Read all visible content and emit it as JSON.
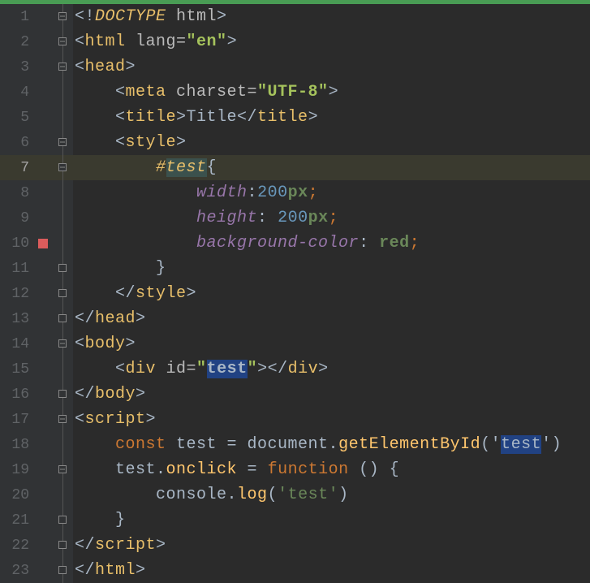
{
  "lines": [
    {
      "n": 1,
      "marker": "",
      "fold": "open",
      "tokens": [
        [
          "punct",
          "<!"
        ],
        [
          "dtype",
          "DOCTYPE "
        ],
        [
          "attr",
          "html"
        ],
        [
          "punct",
          ">"
        ]
      ]
    },
    {
      "n": 2,
      "marker": "",
      "fold": "open",
      "tokens": [
        [
          "punct",
          "<"
        ],
        [
          "tag",
          "html "
        ],
        [
          "attr",
          "lang="
        ],
        [
          "strb",
          "\"en\""
        ],
        [
          "punct",
          ">"
        ]
      ]
    },
    {
      "n": 3,
      "marker": "",
      "fold": "open",
      "tokens": [
        [
          "punct",
          "<"
        ],
        [
          "tag",
          "head"
        ],
        [
          "punct",
          ">"
        ]
      ]
    },
    {
      "n": 4,
      "marker": "",
      "fold": "line",
      "tokens": [
        [
          "punct",
          "    <"
        ],
        [
          "tag",
          "meta "
        ],
        [
          "attr",
          "charset="
        ],
        [
          "strb",
          "\"UTF-8\""
        ],
        [
          "punct",
          ">"
        ]
      ]
    },
    {
      "n": 5,
      "marker": "",
      "fold": "line",
      "tokens": [
        [
          "punct",
          "    <"
        ],
        [
          "tag",
          "title"
        ],
        [
          "punct",
          ">Title</"
        ],
        [
          "tag",
          "title"
        ],
        [
          "punct",
          ">"
        ]
      ]
    },
    {
      "n": 6,
      "marker": "",
      "fold": "open",
      "tokens": [
        [
          "punct",
          "    <"
        ],
        [
          "tag",
          "style"
        ],
        [
          "punct",
          ">"
        ]
      ]
    },
    {
      "n": 7,
      "marker": "",
      "fold": "open",
      "hi": true,
      "tokens": [
        [
          "punct",
          "        "
        ],
        [
          "sel",
          "#"
        ],
        [
          "sel hlword-sel",
          "test"
        ],
        [
          "punct",
          "{"
        ]
      ]
    },
    {
      "n": 8,
      "marker": "",
      "fold": "line",
      "tokens": [
        [
          "punct",
          "            "
        ],
        [
          "prop",
          "width"
        ],
        [
          "punct",
          ":"
        ],
        [
          "num",
          "200"
        ],
        [
          "unit",
          "px"
        ],
        [
          "semi",
          ";"
        ]
      ]
    },
    {
      "n": 9,
      "marker": "",
      "fold": "line",
      "tokens": [
        [
          "punct",
          "            "
        ],
        [
          "prop",
          "height"
        ],
        [
          "punct",
          ": "
        ],
        [
          "num",
          "200"
        ],
        [
          "unit",
          "px"
        ],
        [
          "semi",
          ";"
        ]
      ]
    },
    {
      "n": 10,
      "marker": "bp",
      "fold": "line",
      "tokens": [
        [
          "punct",
          "            "
        ],
        [
          "prop",
          "background-color"
        ],
        [
          "punct",
          ": "
        ],
        [
          "val",
          "red"
        ],
        [
          "semi",
          ";"
        ]
      ]
    },
    {
      "n": 11,
      "marker": "",
      "fold": "close",
      "tokens": [
        [
          "punct",
          "        }"
        ]
      ]
    },
    {
      "n": 12,
      "marker": "",
      "fold": "close",
      "tokens": [
        [
          "punct",
          "    </"
        ],
        [
          "tag",
          "style"
        ],
        [
          "punct",
          ">"
        ]
      ]
    },
    {
      "n": 13,
      "marker": "",
      "fold": "close",
      "tokens": [
        [
          "punct",
          "</"
        ],
        [
          "tag",
          "head"
        ],
        [
          "punct",
          ">"
        ]
      ]
    },
    {
      "n": 14,
      "marker": "",
      "fold": "open",
      "tokens": [
        [
          "punct",
          "<"
        ],
        [
          "tag",
          "body"
        ],
        [
          "punct",
          ">"
        ]
      ]
    },
    {
      "n": 15,
      "marker": "",
      "fold": "line",
      "tokens": [
        [
          "punct",
          "    <"
        ],
        [
          "tag",
          "div "
        ],
        [
          "attr",
          "id="
        ],
        [
          "strb",
          "\""
        ],
        [
          "strb hlword",
          "test"
        ],
        [
          "strb",
          "\""
        ],
        [
          "punct",
          "></"
        ],
        [
          "tag",
          "div"
        ],
        [
          "punct",
          ">"
        ]
      ]
    },
    {
      "n": 16,
      "marker": "",
      "fold": "close",
      "tokens": [
        [
          "punct",
          "</"
        ],
        [
          "tag",
          "body"
        ],
        [
          "punct",
          ">"
        ]
      ]
    },
    {
      "n": 17,
      "marker": "",
      "fold": "open",
      "tokens": [
        [
          "punct",
          "<"
        ],
        [
          "tag",
          "script"
        ],
        [
          "punct",
          ">"
        ]
      ]
    },
    {
      "n": 18,
      "marker": "",
      "fold": "line",
      "tokens": [
        [
          "punct",
          "    "
        ],
        [
          "kw",
          "const "
        ],
        [
          "punct",
          "test = document."
        ],
        [
          "fn",
          "getElementById"
        ],
        [
          "punct",
          "('"
        ],
        [
          "jsstr hlword",
          "test"
        ],
        [
          "punct",
          "')"
        ]
      ]
    },
    {
      "n": 19,
      "marker": "",
      "fold": "open",
      "tokens": [
        [
          "punct",
          "    test."
        ],
        [
          "fn",
          "onclick "
        ],
        [
          "punct",
          "= "
        ],
        [
          "kw",
          "function "
        ],
        [
          "punct",
          "() {"
        ]
      ]
    },
    {
      "n": 20,
      "marker": "",
      "fold": "line",
      "tokens": [
        [
          "punct",
          "        console."
        ],
        [
          "fn",
          "log"
        ],
        [
          "punct",
          "("
        ],
        [
          "jsstr",
          "'test'"
        ],
        [
          "punct",
          ")"
        ]
      ]
    },
    {
      "n": 21,
      "marker": "",
      "fold": "close",
      "tokens": [
        [
          "punct",
          "    }"
        ]
      ]
    },
    {
      "n": 22,
      "marker": "",
      "fold": "close",
      "tokens": [
        [
          "punct",
          "</"
        ],
        [
          "tag",
          "script"
        ],
        [
          "punct",
          ">"
        ]
      ]
    },
    {
      "n": 23,
      "marker": "",
      "fold": "close",
      "tokens": [
        [
          "punct",
          "</"
        ],
        [
          "tag",
          "html"
        ],
        [
          "punct",
          ">"
        ]
      ]
    }
  ]
}
